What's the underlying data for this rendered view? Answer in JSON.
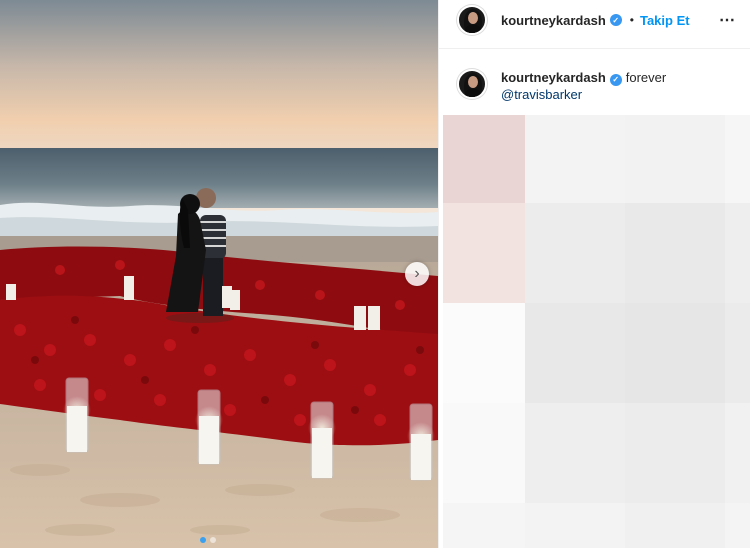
{
  "post": {
    "author": "kourtneykardash",
    "follow_label": "Takip Et",
    "separator": "•",
    "more_icon": "⋯"
  },
  "caption": {
    "author": "kourtneykardash",
    "text": "forever",
    "mention": "@travisbarker"
  },
  "carousel": {
    "next_icon": "›",
    "slide_count": 2,
    "active_slide": 1
  },
  "colors": {
    "accent": "#0095f6",
    "verified": "#3897f0",
    "mention": "#00376b"
  },
  "icons": [
    "verified-badge-icon",
    "more-options-icon",
    "chevron-right-icon"
  ]
}
